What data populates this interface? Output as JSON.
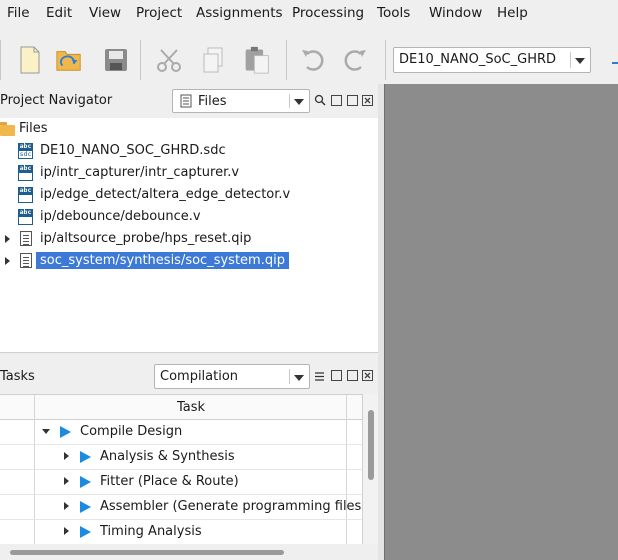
{
  "menu": [
    "File",
    "Edit",
    "View",
    "Project",
    "Assignments",
    "Processing",
    "Tools",
    "Window",
    "Help"
  ],
  "toolbar": {
    "revision": "DE10_NANO_SoC_GHRD",
    "icons": [
      "new-file-icon",
      "open-project-icon",
      "save-icon",
      "cut-icon",
      "copy-icon",
      "paste-icon",
      "undo-icon",
      "redo-icon"
    ]
  },
  "project_navigator": {
    "title": "Project Navigator",
    "view": "Files",
    "root": "Files",
    "files": [
      {
        "name": "DE10_NANO_SOC_GHRD.sdc",
        "icon": "abc-sdc-icon",
        "expandable": false,
        "selected": false
      },
      {
        "name": "ip/intr_capturer/intr_capturer.v",
        "icon": "abc-file-icon",
        "expandable": false,
        "selected": false
      },
      {
        "name": "ip/edge_detect/altera_edge_detector.v",
        "icon": "abc-file-icon",
        "expandable": false,
        "selected": false
      },
      {
        "name": "ip/debounce/debounce.v",
        "icon": "abc-file-icon",
        "expandable": false,
        "selected": false
      },
      {
        "name": "ip/altsource_probe/hps_reset.qip",
        "icon": "document-icon",
        "expandable": true,
        "selected": false
      },
      {
        "name": "soc_system/synthesis/soc_system.qip",
        "icon": "document-icon",
        "expandable": true,
        "selected": true
      }
    ]
  },
  "tasks": {
    "title": "Tasks",
    "flow": "Compilation",
    "column": "Task",
    "rows": [
      {
        "label": "Compile Design",
        "level": 0,
        "expanded": true
      },
      {
        "label": "Analysis & Synthesis",
        "level": 1,
        "expanded": false
      },
      {
        "label": "Fitter (Place & Route)",
        "level": 1,
        "expanded": false
      },
      {
        "label": "Assembler (Generate programming files)",
        "level": 1,
        "expanded": false
      },
      {
        "label": "Timing Analysis",
        "level": 1,
        "expanded": false
      }
    ]
  },
  "colors": {
    "selection": "#3d7ad7",
    "play": "#1a8be0",
    "workspace": "#8c8c8c"
  }
}
